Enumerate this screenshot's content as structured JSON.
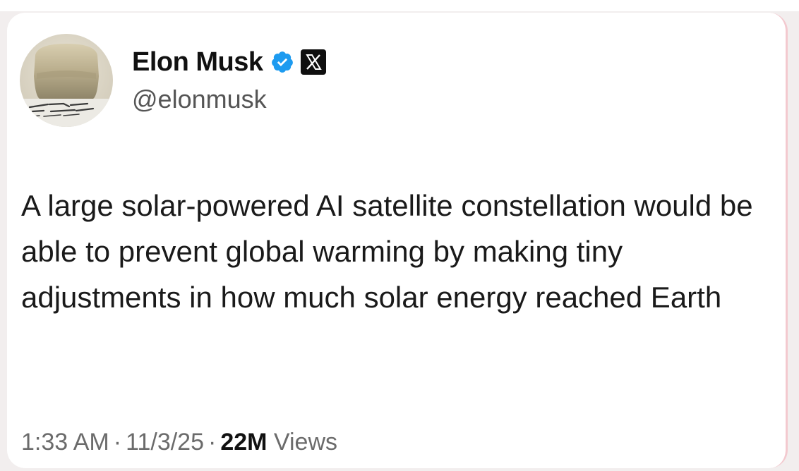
{
  "tweet": {
    "author": {
      "display_name": "Elon Musk",
      "handle": "@elonmusk",
      "verified_badge_icon": "verified-badge-icon",
      "affiliation_icon": "x-logo-icon",
      "avatar_icon": "avatar-photo"
    },
    "text": "A large solar-powered AI satellite constellation would be able to prevent global warming by making tiny adjustments in how much solar energy reached Earth",
    "meta": {
      "time": "1:33 AM",
      "separator": "·",
      "date": "11/3/25",
      "views_count": "22M",
      "views_label": "Views"
    }
  },
  "colors": {
    "verified_blue": "#1d9bf0",
    "text_primary": "#111111",
    "text_secondary": "#555555",
    "card_border": "#f3c9cf"
  }
}
